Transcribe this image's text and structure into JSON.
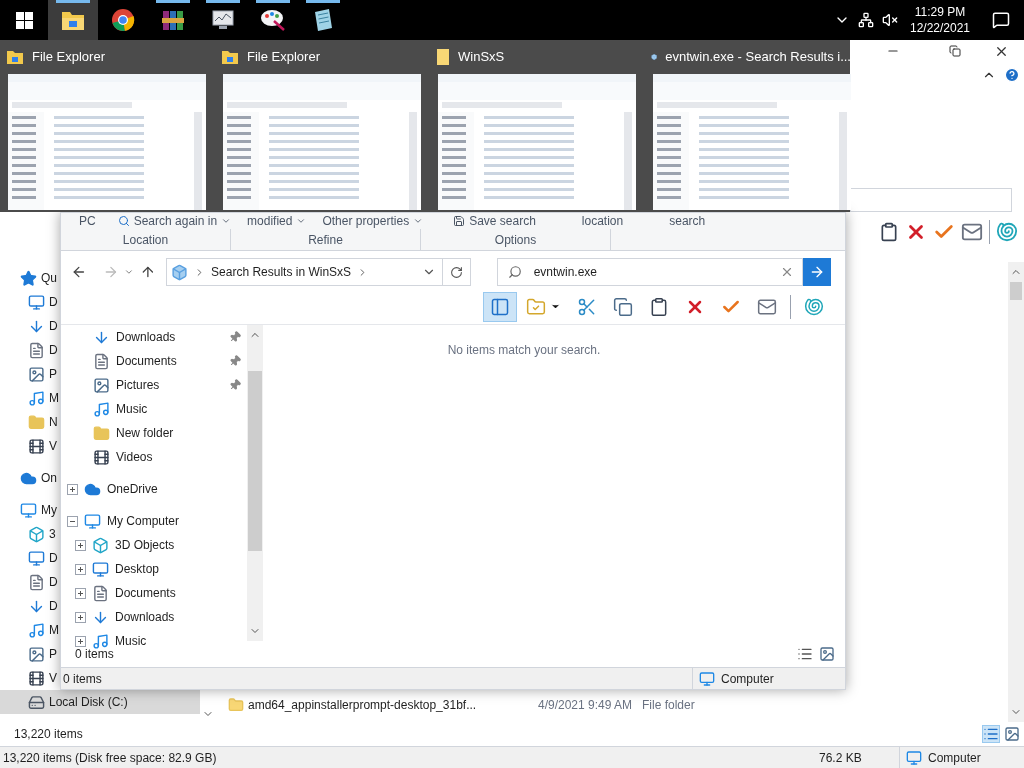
{
  "taskbar": {
    "apps": [
      {
        "kind": "file-explorer",
        "selected": true,
        "running": true
      },
      {
        "kind": "browser",
        "selected": false,
        "running": false
      },
      {
        "kind": "archiver",
        "selected": false,
        "running": true
      },
      {
        "kind": "monitor",
        "selected": false,
        "running": true
      },
      {
        "kind": "paint",
        "selected": false,
        "running": true
      },
      {
        "kind": "notepad",
        "selected": false,
        "running": true
      }
    ],
    "clock": {
      "time": "11:29 PM",
      "date": "12/22/2021"
    }
  },
  "thumbnails": [
    {
      "title": "File Explorer",
      "kind": "explorer"
    },
    {
      "title": "File Explorer",
      "kind": "explorer"
    },
    {
      "title": "WinSxS",
      "kind": "folder"
    },
    {
      "title": "evntwin.exe - Search Results i...",
      "kind": "search"
    }
  ],
  "background_window": {
    "nav": [
      {
        "label": "Qu",
        "kind": "star",
        "selected": false,
        "children": [
          {
            "label": "D",
            "kind": "desktop",
            "selected": false
          },
          {
            "label": "D",
            "kind": "download",
            "selected": false
          },
          {
            "label": "D",
            "kind": "document",
            "selected": false
          },
          {
            "label": "P",
            "kind": "picture",
            "selected": false
          },
          {
            "label": "M",
            "kind": "music",
            "selected": false
          },
          {
            "label": "N",
            "kind": "folder",
            "selected": false
          },
          {
            "label": "V",
            "kind": "video",
            "selected": false
          }
        ]
      },
      {
        "label": "On",
        "kind": "cloud",
        "selected": false
      },
      {
        "label": "My",
        "kind": "computer",
        "selected": false,
        "children": [
          {
            "label": "3",
            "kind": "cube",
            "selected": false
          },
          {
            "label": "D",
            "kind": "desktop",
            "selected": false
          },
          {
            "label": "D",
            "kind": "document",
            "selected": false
          },
          {
            "label": "D",
            "kind": "download",
            "selected": false
          },
          {
            "label": "M",
            "kind": "music",
            "selected": false
          },
          {
            "label": "P",
            "kind": "picture",
            "selected": false
          },
          {
            "label": "V",
            "kind": "video",
            "selected": false
          },
          {
            "label": "Local Disk (C:)",
            "kind": "disk",
            "selected": true
          }
        ]
      }
    ],
    "file_row": {
      "name": "amd64_appinstallerprompt-desktop_31bf...",
      "date": "4/9/2021 9:49 AM",
      "type": "File folder"
    },
    "item_count": "13,220 items",
    "status": {
      "summary": "13,220 items (Disk free space: 82.9 GB)",
      "size": "76.2 KB",
      "location": "Computer"
    }
  },
  "front_window": {
    "ribbon_fragments": [
      {
        "text": "PC",
        "kind": "plain"
      },
      {
        "text": "Search again in",
        "kind": "search-menu"
      },
      {
        "text": "modified",
        "kind": "menu"
      },
      {
        "text": "Other properties",
        "kind": "menu"
      },
      {
        "text": "Save search",
        "kind": "save"
      },
      {
        "text": "location",
        "kind": "plain"
      },
      {
        "text": "search",
        "kind": "plain"
      }
    ],
    "ribbon_groups": [
      "Location",
      "Refine",
      "Options"
    ],
    "address": "Search Results in WinSxS",
    "search": {
      "value": "evntwin.exe"
    },
    "toolbar": [
      {
        "kind": "pane",
        "selected": true
      },
      {
        "kind": "folder-check",
        "selected": false
      },
      {
        "kind": "cut",
        "selected": false
      },
      {
        "kind": "copy",
        "selected": false
      },
      {
        "kind": "paste",
        "selected": false
      },
      {
        "kind": "delete",
        "selected": false
      },
      {
        "kind": "check",
        "selected": false
      },
      {
        "kind": "mail",
        "selected": false
      },
      {
        "kind": "shell",
        "selected": false
      }
    ],
    "quick_access": [
      {
        "label": "Downloads",
        "kind": "download",
        "pinned": true
      },
      {
        "label": "Documents",
        "kind": "document",
        "pinned": true
      },
      {
        "label": "Pictures",
        "kind": "picture",
        "pinned": true
      },
      {
        "label": "Music",
        "kind": "music",
        "pinned": false
      },
      {
        "label": "New folder",
        "kind": "folder",
        "pinned": false
      },
      {
        "label": "Videos",
        "kind": "video",
        "pinned": false
      }
    ],
    "tree": [
      {
        "label": "OneDrive",
        "kind": "cloud",
        "expanded": false
      },
      {
        "label": "My Computer",
        "kind": "computer",
        "expanded": true,
        "children": [
          {
            "label": "3D Objects",
            "kind": "cube",
            "expanded": false
          },
          {
            "label": "Desktop",
            "kind": "desktop",
            "expanded": false
          },
          {
            "label": "Documents",
            "kind": "document",
            "expanded": false
          },
          {
            "label": "Downloads",
            "kind": "download",
            "expanded": false
          },
          {
            "label": "Music",
            "kind": "music",
            "expanded": false
          }
        ]
      }
    ],
    "empty_message": "No items match your search.",
    "item_count": "0 items",
    "status": {
      "count": "0 items",
      "location": "Computer"
    }
  }
}
